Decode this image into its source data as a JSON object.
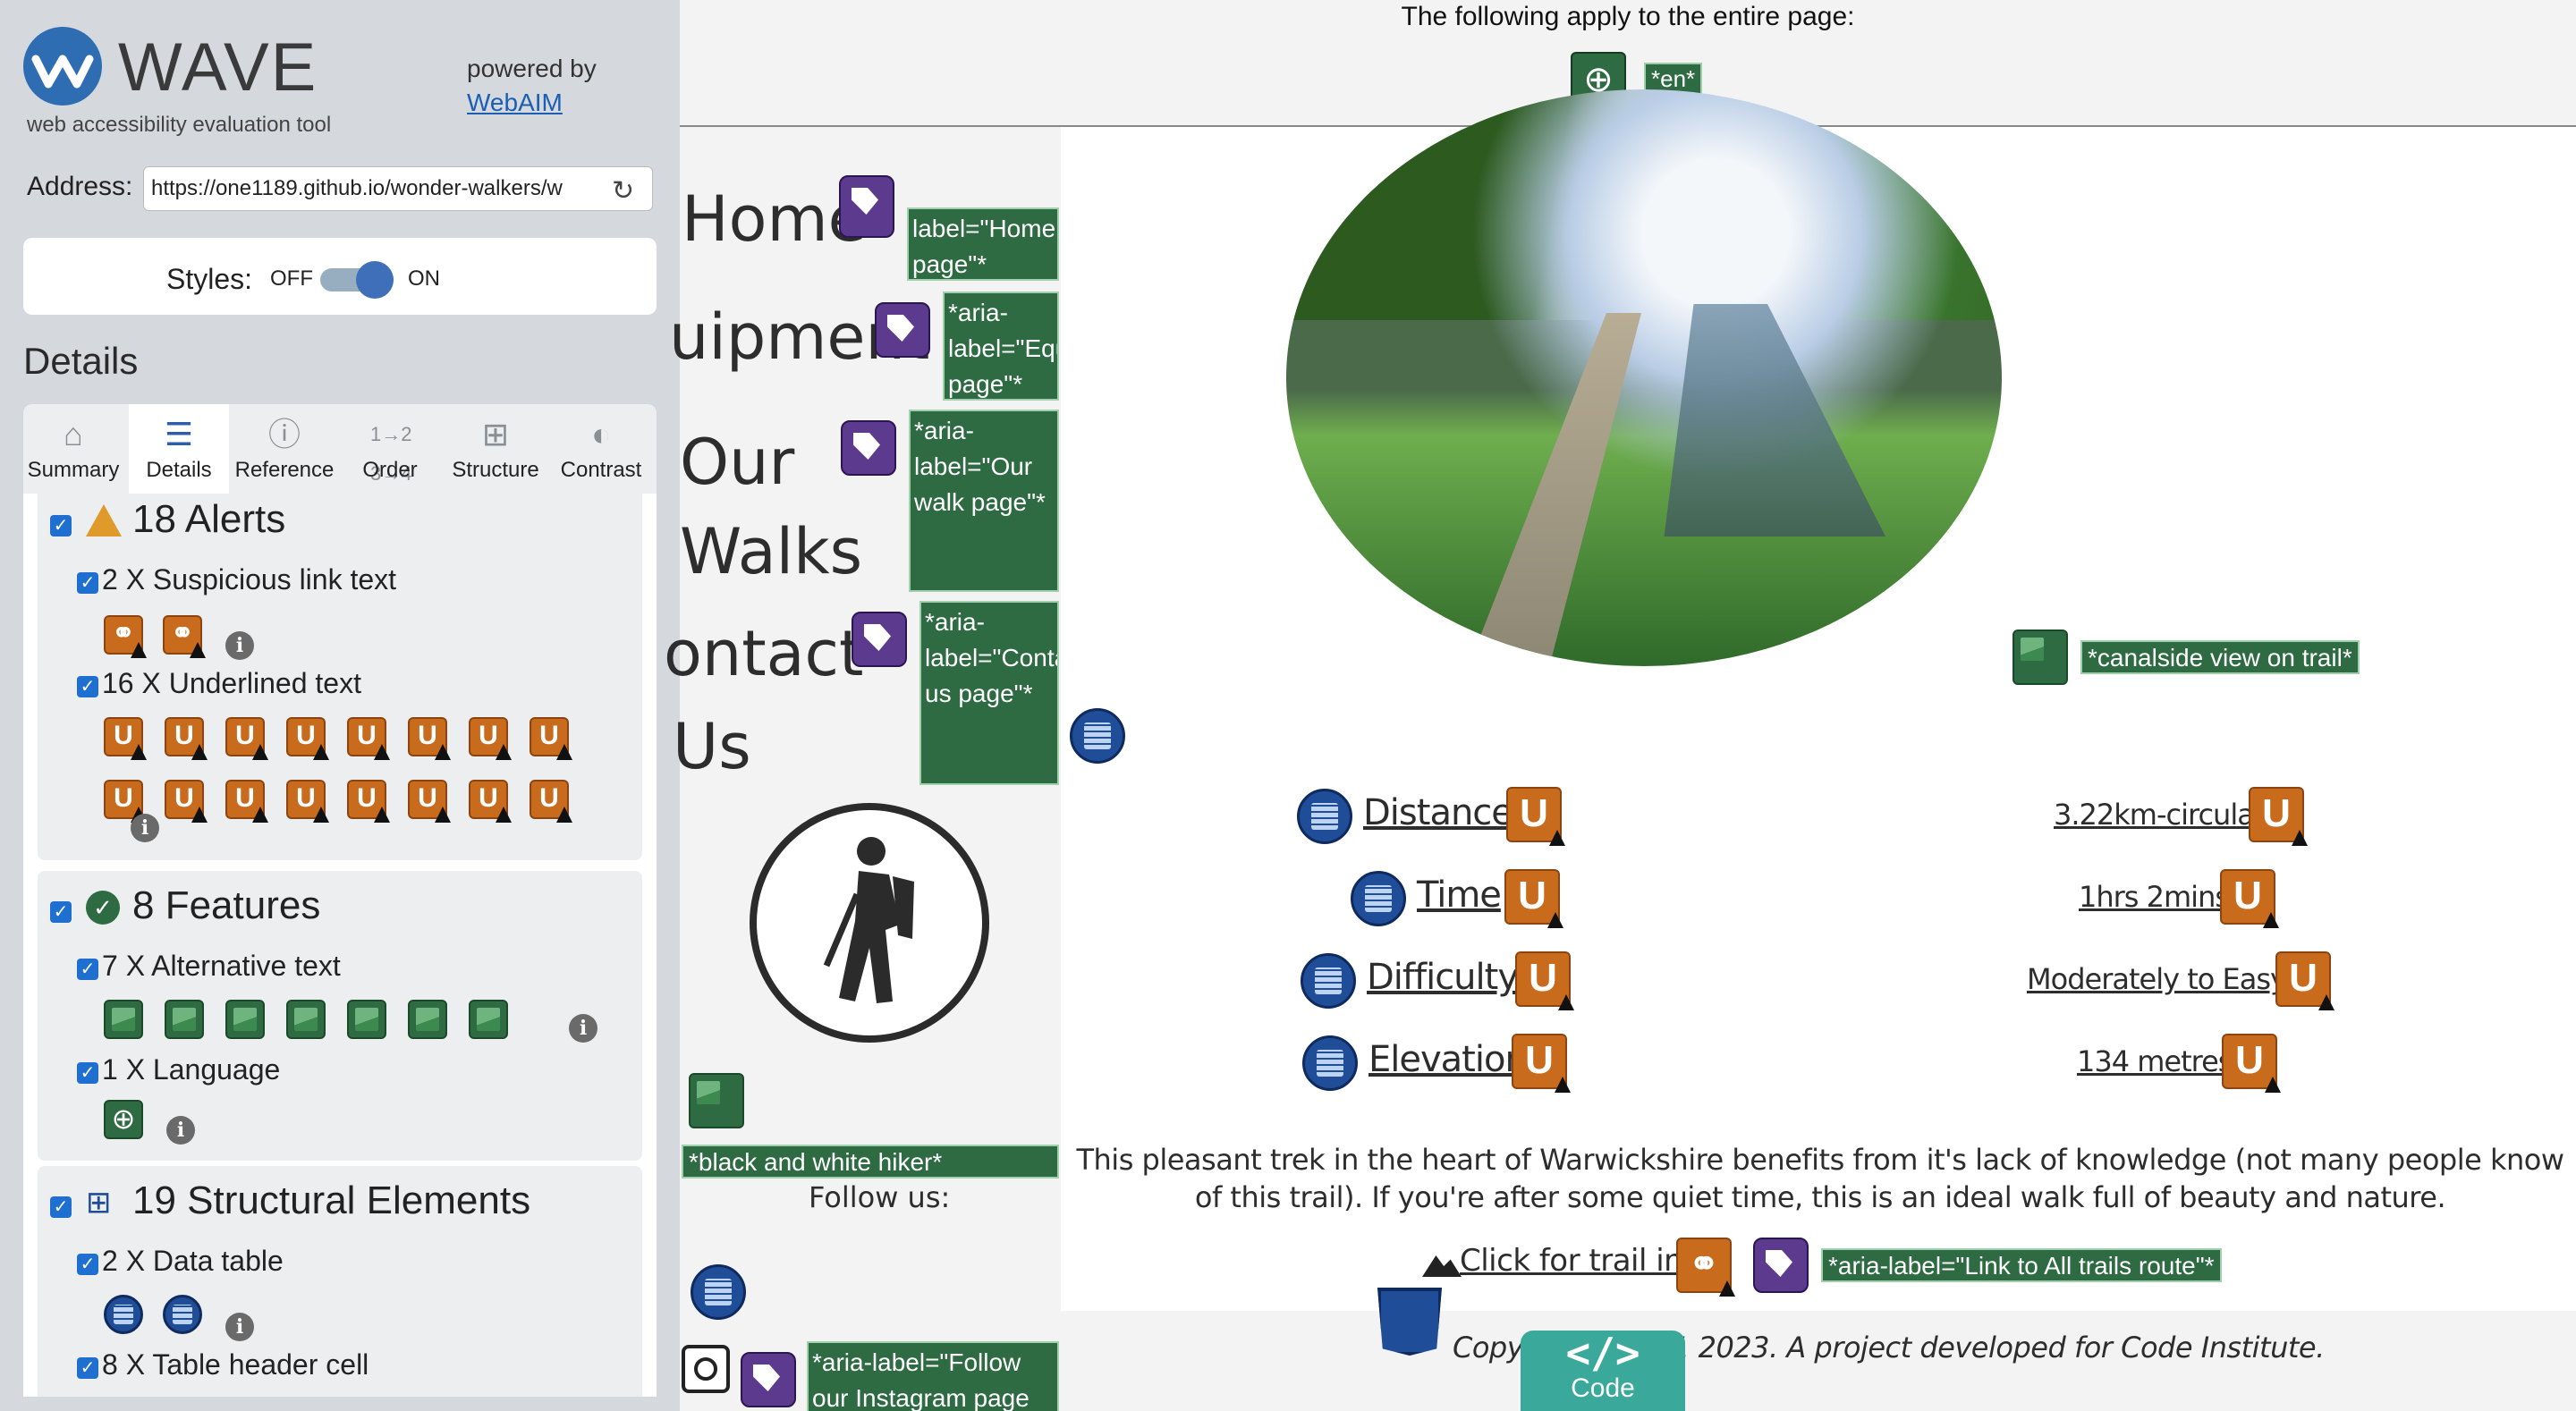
{
  "wave": {
    "logo_text": "WAVE",
    "subtitle": "web accessibility evaluation tool",
    "powered_by": "powered by",
    "webaim": "WebAIM",
    "address_label": "Address:",
    "address_value": "https://one1189.github.io/wonder-walkers/w",
    "styles_label": "Styles:",
    "styles_off": "OFF",
    "styles_on": "ON",
    "details_heading": "Details",
    "tabs": [
      {
        "label": "Summary",
        "icon": "home-icon"
      },
      {
        "label": "Details",
        "icon": "list-icon",
        "active": true
      },
      {
        "label": "Reference",
        "icon": "info-icon"
      },
      {
        "label": "Order",
        "icon": "order-icon"
      },
      {
        "label": "Structure",
        "icon": "sitemap-icon"
      },
      {
        "label": "Contrast",
        "icon": "contrast-icon"
      }
    ],
    "alerts": {
      "heading": "18 Alerts",
      "suspicious": "2 X Suspicious link text",
      "suspicious_count": 2,
      "underlined": "16 X Underlined text",
      "underlined_count": 16
    },
    "features": {
      "heading": "8 Features",
      "alt": "7 X Alternative text",
      "alt_count": 7,
      "language": "1 X Language",
      "language_count": 1
    },
    "structure": {
      "heading": "19 Structural Elements",
      "data_table": "2 X Data table",
      "data_table_count": 2,
      "header_cell": "8 X Table header cell"
    }
  },
  "page": {
    "top_notice": "The following apply to the entire page:",
    "lang_tag": "*en*",
    "nav": [
      {
        "text": "Home",
        "label": "label=\"Home page\"*"
      },
      {
        "text": "uipment",
        "label": "*aria-label=\"Equ page\"*"
      },
      {
        "text": "Our",
        "text2": "Walks",
        "label": "*aria-label=\"Our walk page\"*"
      },
      {
        "text": "ontact",
        "text2": "Us",
        "label": "*aria-label=\"Conta us page\"*"
      }
    ],
    "hero_alt": "*canalside view on trail*",
    "hiker_alt": "*black and white hiker*",
    "follow_us": "Follow us:",
    "instagram_label": "*aria-label=\"Follow our Instagram page",
    "table": [
      {
        "header": "Distance",
        "value": "3.22km-circular"
      },
      {
        "header": "Time",
        "value": "1hrs 2mins"
      },
      {
        "header": "Difficulty",
        "value": "Moderately to Easy"
      },
      {
        "header": "Elevation",
        "value": "134 metres"
      }
    ],
    "description": "This pleasant trek in the heart of Warwickshire benefits from it's lack of knowledge (not many people know of this trail). If you're after some quiet time, this is an ideal walk full of beauty and nature.",
    "trail_link": "Click for trail info",
    "trail_aria": "*aria-label=\"Link to All trails route\"*",
    "footer": "Copyright One11 2023. A project developed for Code Institute.",
    "code_symbol": "</>",
    "code_label": "Code"
  },
  "colors": {
    "alert": "#c96b1d",
    "feature": "#2e6b43",
    "structure": "#1f4d97",
    "aria": "#5c3b8e",
    "sidebar": "#d5d9dd"
  }
}
